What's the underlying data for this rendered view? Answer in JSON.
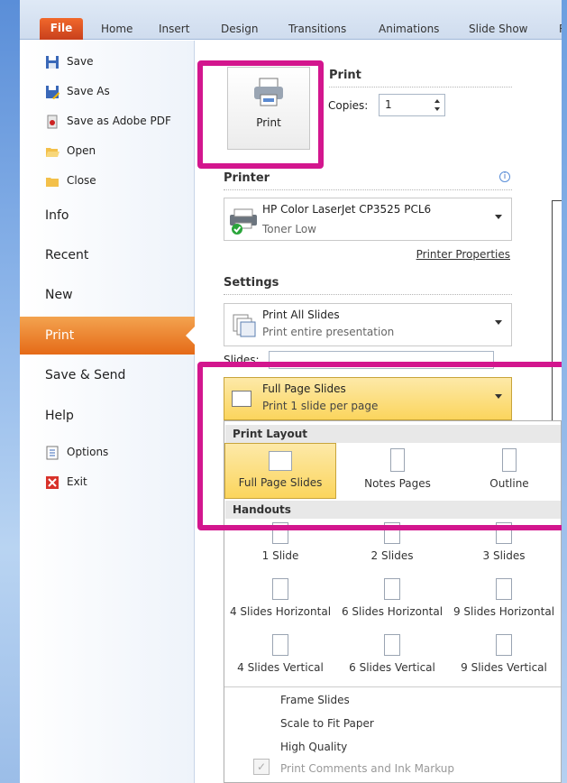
{
  "ribbon": {
    "tabs": [
      "File",
      "Home",
      "Insert",
      "Design",
      "Transitions",
      "Animations",
      "Slide Show",
      "R"
    ]
  },
  "nav": {
    "small_top": [
      {
        "label": "Save",
        "icon": "save-icon"
      },
      {
        "label": "Save As",
        "icon": "save-as-icon"
      },
      {
        "label": "Save as Adobe PDF",
        "icon": "pdf-icon"
      },
      {
        "label": "Open",
        "icon": "open-folder-icon"
      },
      {
        "label": "Close",
        "icon": "close-folder-icon"
      }
    ],
    "big": [
      "Info",
      "Recent",
      "New",
      "Print",
      "Save & Send",
      "Help"
    ],
    "small_bottom": [
      {
        "label": "Options",
        "icon": "options-icon"
      },
      {
        "label": "Exit",
        "icon": "exit-icon"
      }
    ]
  },
  "print": {
    "heading": "Print",
    "button_label": "Print",
    "copies_label": "Copies:",
    "copies_value": "1"
  },
  "printer": {
    "heading": "Printer",
    "name": "HP Color LaserJet CP3525 PCL6",
    "status": "Toner Low",
    "properties_link": "Printer Properties"
  },
  "settings": {
    "heading": "Settings",
    "slides_dd": {
      "title": "Print All Slides",
      "subtitle": "Print entire presentation"
    },
    "slides_label": "Slides:",
    "layout_dd": {
      "title": "Full Page Slides",
      "subtitle": "Print 1 slide per page"
    }
  },
  "gallery": {
    "print_layout_header": "Print Layout",
    "print_layout": [
      "Full Page Slides",
      "Notes Pages",
      "Outline"
    ],
    "handouts_header": "Handouts",
    "handouts_row1": [
      "1 Slide",
      "2 Slides",
      "3 Slides"
    ],
    "handouts_row2": [
      "4 Slides Horizontal",
      "6 Slides Horizontal",
      "9 Slides Horizontal"
    ],
    "handouts_row3": [
      "4 Slides Vertical",
      "6 Slides Vertical",
      "9 Slides Vertical"
    ],
    "options": [
      "Frame Slides",
      "Scale to Fit Paper",
      "High Quality",
      "Print Comments and Ink Markup"
    ]
  },
  "colors": {
    "highlight": "#d3168e",
    "accent_orange": "#e56a17",
    "selected": "#fbd96a"
  }
}
